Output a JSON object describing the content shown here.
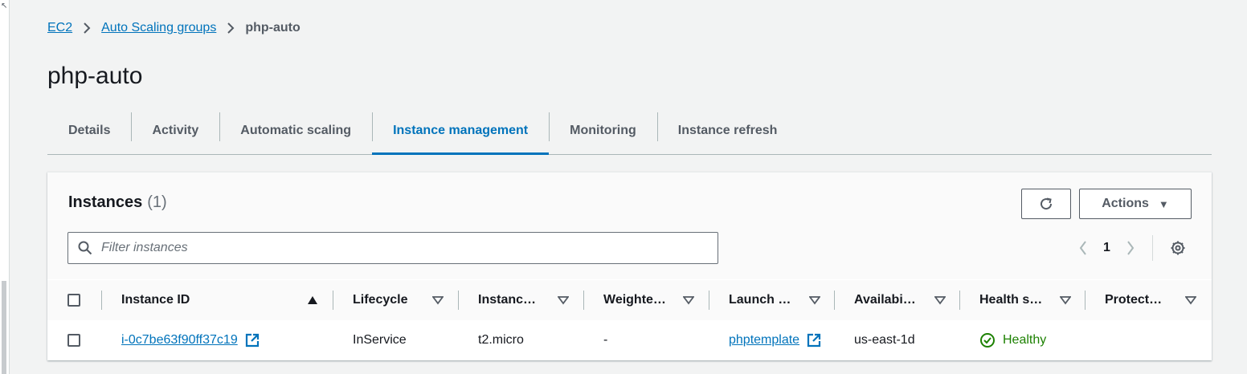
{
  "breadcrumb": {
    "items": [
      "EC2",
      "Auto Scaling groups"
    ],
    "current": "php-auto"
  },
  "page": {
    "title": "php-auto"
  },
  "tabs": [
    {
      "label": "Details",
      "active": false
    },
    {
      "label": "Activity",
      "active": false
    },
    {
      "label": "Automatic scaling",
      "active": false
    },
    {
      "label": "Instance management",
      "active": true
    },
    {
      "label": "Monitoring",
      "active": false
    },
    {
      "label": "Instance refresh",
      "active": false
    }
  ],
  "panel": {
    "title": "Instances",
    "count": "(1)",
    "actions_label": "Actions",
    "filter_placeholder": "Filter instances",
    "page_number": "1"
  },
  "table": {
    "columns": [
      "Instance ID",
      "Lifecycle",
      "Instanc…",
      "Weighte…",
      "Launch …",
      "Availabi…",
      "Health s…",
      "Protect…"
    ],
    "rows": [
      {
        "instance_id": "i-0c7be63f90ff37c19",
        "lifecycle": "InService",
        "instance_type": "t2.micro",
        "weighted": "-",
        "launch_template": "phptemplate",
        "availability_zone": "us-east-1d",
        "health_status": "Healthy",
        "protection": ""
      }
    ]
  },
  "colors": {
    "link": "#0073bb",
    "healthy": "#1d8102",
    "background": "#f2f3f3"
  },
  "icons": [
    "chevron-right-icon",
    "refresh-icon",
    "caret-down-icon",
    "search-icon",
    "chevron-left-icon",
    "settings-icon",
    "sort-ascending-icon",
    "sort-descending-icon",
    "external-link-icon",
    "status-healthy-icon"
  ]
}
